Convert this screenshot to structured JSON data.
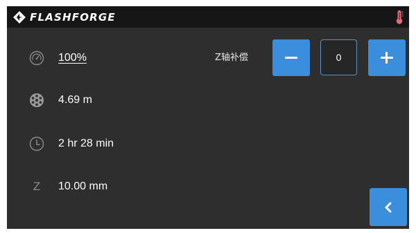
{
  "header": {
    "brand": "FLASHFORGE",
    "logo_icon": "flashforge-logo-icon",
    "status_icon": "thermometer-icon"
  },
  "stats": [
    {
      "icon": "speedometer-icon",
      "value": "100%"
    },
    {
      "icon": "filament-spool-icon",
      "value": "4.69 m"
    },
    {
      "icon": "clock-icon",
      "value": "2 hr 28 min"
    },
    {
      "icon": "z-axis-icon",
      "icon_text": "Z",
      "value": "10.00 mm"
    }
  ],
  "z_offset": {
    "label": "Z轴补偿",
    "value": "0",
    "decrease_icon": "minus-icon",
    "increase_icon": "plus-icon"
  },
  "back_button": {
    "icon": "chevron-left-icon"
  },
  "colors": {
    "accent": "#3a8edb",
    "body": "#2e2e2e",
    "topbar": "#161616",
    "icon": "#8c8c8c",
    "thermo": "#e07078",
    "box_border": "#5d93c4"
  }
}
